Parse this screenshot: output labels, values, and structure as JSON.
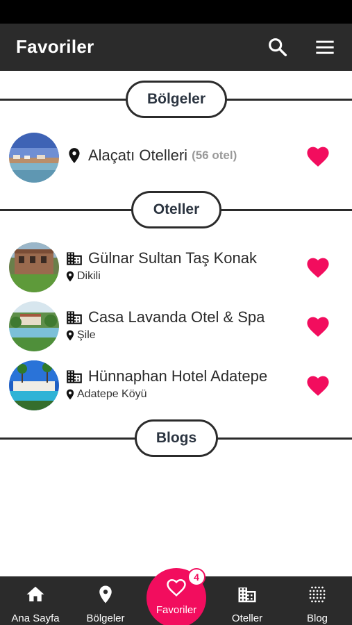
{
  "app": {
    "title": "Favoriler"
  },
  "header": {
    "search_icon": "search-icon",
    "menu_icon": "hamburger-menu-icon"
  },
  "sections": {
    "regions": "Bölgeler",
    "hotels": "Oteller",
    "blogs": "Blogs"
  },
  "regions": [
    {
      "name": "Alaçatı Otelleri",
      "count": "(56 otel)",
      "favorited": true
    }
  ],
  "hotels": [
    {
      "name": "Gülnar Sultan Taş Konak",
      "location": "Dikili",
      "favorited": true
    },
    {
      "name": "Casa Lavanda Otel & Spa",
      "location": "Şile",
      "favorited": true
    },
    {
      "name": "Hünnaphan Hotel Adatepe",
      "location": "Adatepe Köyü",
      "favorited": true
    }
  ],
  "bottom_nav": {
    "home": "Ana Sayfa",
    "regions": "Bölgeler",
    "favorites": "Favoriler",
    "favorites_badge": "4",
    "hotels": "Oteller",
    "blog": "Blog"
  },
  "colors": {
    "accent": "#f20d5e",
    "header": "#2b2b2b",
    "status_bar": "#000000"
  }
}
